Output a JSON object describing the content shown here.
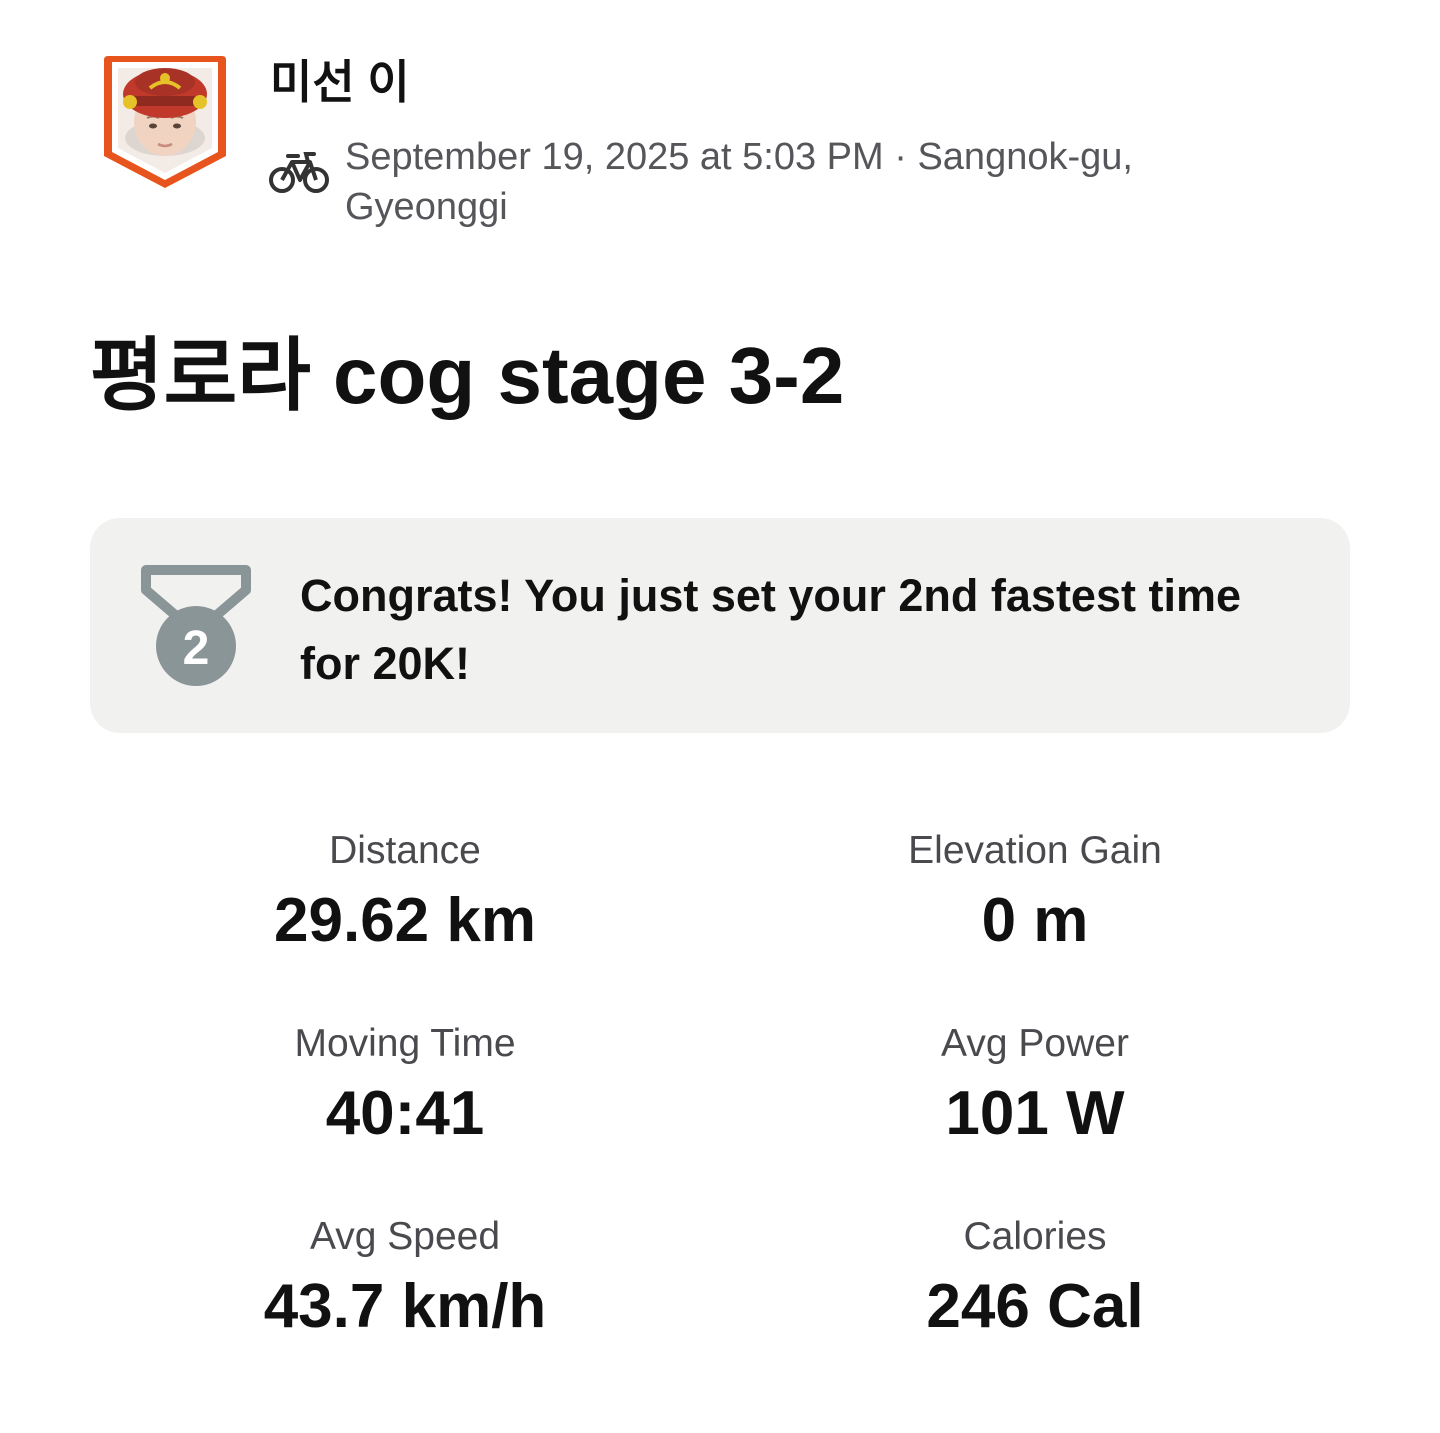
{
  "athlete": {
    "name": "미선 이",
    "avatar_icon": "avatar-badge-icon"
  },
  "activity": {
    "type_icon": "bike-icon",
    "meta": "September 19, 2025 at 5:03 PM · Sangnok-gu, Gyeonggi",
    "title": "평로라 cog stage 3-2"
  },
  "achievement": {
    "icon": "silver-medal-icon",
    "medal_number": "2",
    "text": "Congrats! You just set your 2nd fastest time for 20K!"
  },
  "stats": [
    {
      "label": "Distance",
      "value": "29.62 km"
    },
    {
      "label": "Elevation Gain",
      "value": "0 m"
    },
    {
      "label": "Moving Time",
      "value": "40:41"
    },
    {
      "label": "Avg Power",
      "value": "101 W"
    },
    {
      "label": "Avg Speed",
      "value": "43.7 km/h"
    },
    {
      "label": "Calories",
      "value": "246 Cal"
    }
  ],
  "colors": {
    "accent_orange": "#e8541e",
    "text_primary": "#111111",
    "text_secondary": "#55555a",
    "card_background": "#f1f1f0",
    "medal_gray": "#8a9598"
  }
}
